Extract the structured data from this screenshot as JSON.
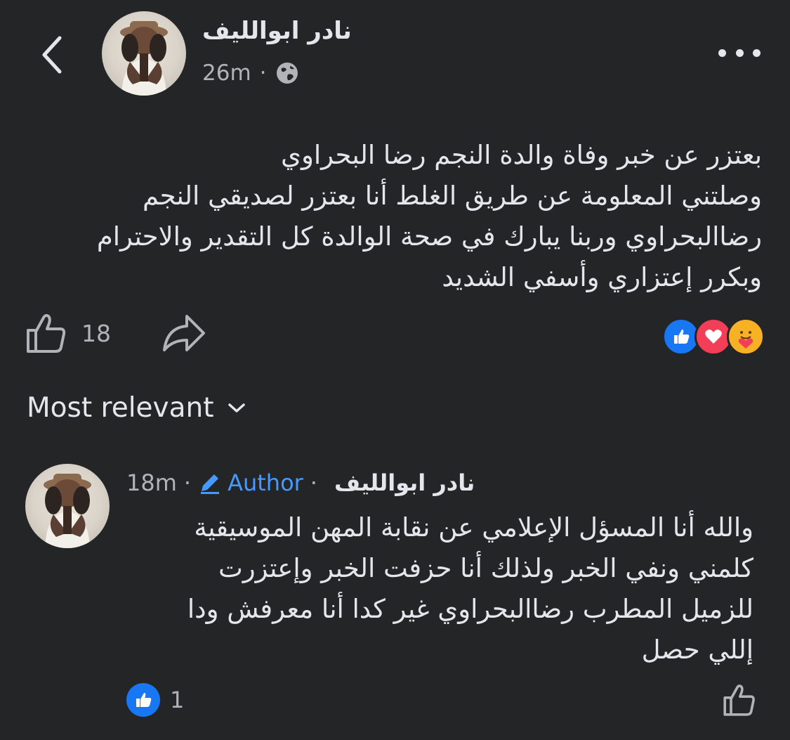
{
  "post": {
    "author": "نادر ابوالليف",
    "time": "26m",
    "separator": "·",
    "privacy_icon": "globe-icon",
    "lines": [
      "بعتزر عن خبر وفاة والدة النجم رضا البحراوي",
      "وصلتني المعلومة عن طريق الغلط أنا بعتزر لصديقي النجم",
      "رضاالبحراوي وربنا يبارك في صحة الوالدة كل التقدير والاحترام",
      "وبكرر إعتزاري وأسفي الشديد"
    ],
    "like_count": "18",
    "reactions": [
      "like-reaction-icon",
      "love-reaction-icon",
      "care-reaction-icon"
    ]
  },
  "comments_section": {
    "sort_label": "Most relevant"
  },
  "comment": {
    "time": "18m",
    "separator": "·",
    "badge_label": "Author",
    "author": "نادر ابوالليف",
    "lines": [
      "والله أنا المسؤل الإعلامي عن نقابة المهن الموسيقية",
      "كلمني ونفي الخبر ولذلك أنا حزفت الخبر وإعتزرت",
      "للزميل المطرب رضاالبحراوي غير كدا أنا معرفش ودا",
      "إللي حصل"
    ],
    "like_count": "1"
  },
  "colors": {
    "background": "#242526",
    "text": "#e4e6eb",
    "secondary_text": "#b0b3b8",
    "accent_blue": "#4599ff",
    "love_red": "#f33e58"
  }
}
